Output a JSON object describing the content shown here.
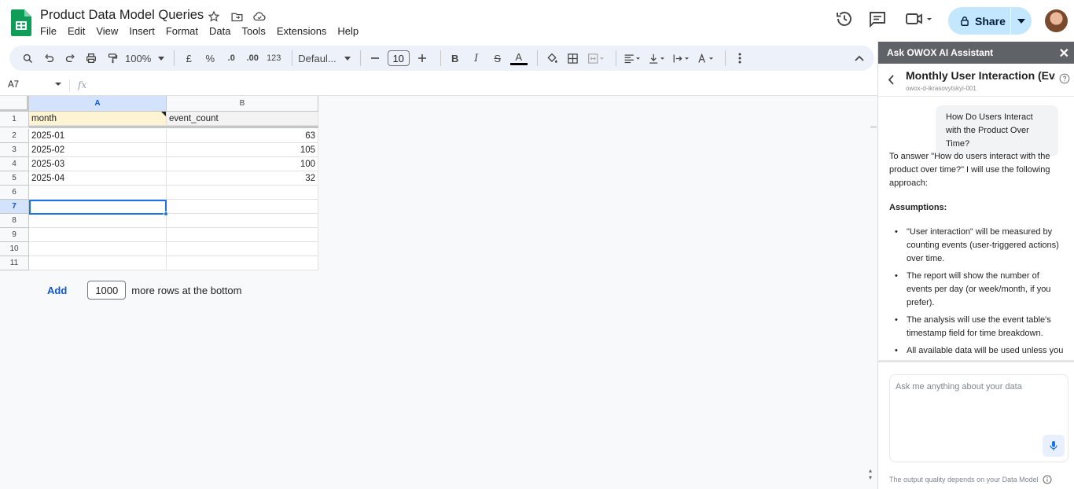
{
  "doc": {
    "title": "Product Data Model Queries",
    "menu": [
      "File",
      "Edit",
      "View",
      "Insert",
      "Format",
      "Data",
      "Tools",
      "Extensions",
      "Help"
    ]
  },
  "share": {
    "label": "Share"
  },
  "toolbar": {
    "zoom": "100%",
    "currency": "£",
    "percent": "%",
    "dec_decrease": ".0",
    "dec_increase": ".00",
    "number_format": "123",
    "font": "Defaul...",
    "font_size": "10",
    "bold": "B",
    "italic": "I",
    "strike": "S",
    "text_color": "A"
  },
  "formula": {
    "namebox": "A7",
    "fx": "fx"
  },
  "sheet": {
    "columns": [
      "A",
      "B"
    ],
    "rows": [
      "1",
      "2",
      "3",
      "4",
      "5",
      "6",
      "7",
      "8",
      "9",
      "10",
      "11"
    ],
    "header": [
      "month",
      "event_count"
    ],
    "data": [
      [
        "2025-01",
        "63"
      ],
      [
        "2025-02",
        "105"
      ],
      [
        "2025-03",
        "100"
      ],
      [
        "2025-04",
        "32"
      ]
    ],
    "active_cell": "A7",
    "add_label": "Add",
    "add_count": "1000",
    "add_suffix": "more rows at the bottom"
  },
  "panel": {
    "header": "Ask OWOX AI Assistant",
    "title": "Monthly User Interaction (Ev...",
    "subtitle": "owox-d-ikrasovytskyi-001",
    "user_question": "How Do Users Interact with the Product Over Time?",
    "answer_intro": "To answer \"How do users interact with the product over time?\" I will use the following approach:",
    "assumptions_label": "Assumptions:",
    "bullets": [
      "\"User interaction\" will be measured by counting events (user-triggered actions) over time.",
      "The report will show the number of events per day (or week/month, if you prefer).",
      "The analysis will use the event table's timestamp field for time breakdown.",
      "All available data will be used unless you"
    ],
    "input_placeholder": "Ask me anything about your data",
    "footer": "The output quality depends on your Data Model"
  },
  "colors": {
    "accent": "#1a73e8",
    "share_bg": "#c2e7ff",
    "header_cell_bg": "#fef3d2",
    "panel_header": "#5f6368"
  }
}
